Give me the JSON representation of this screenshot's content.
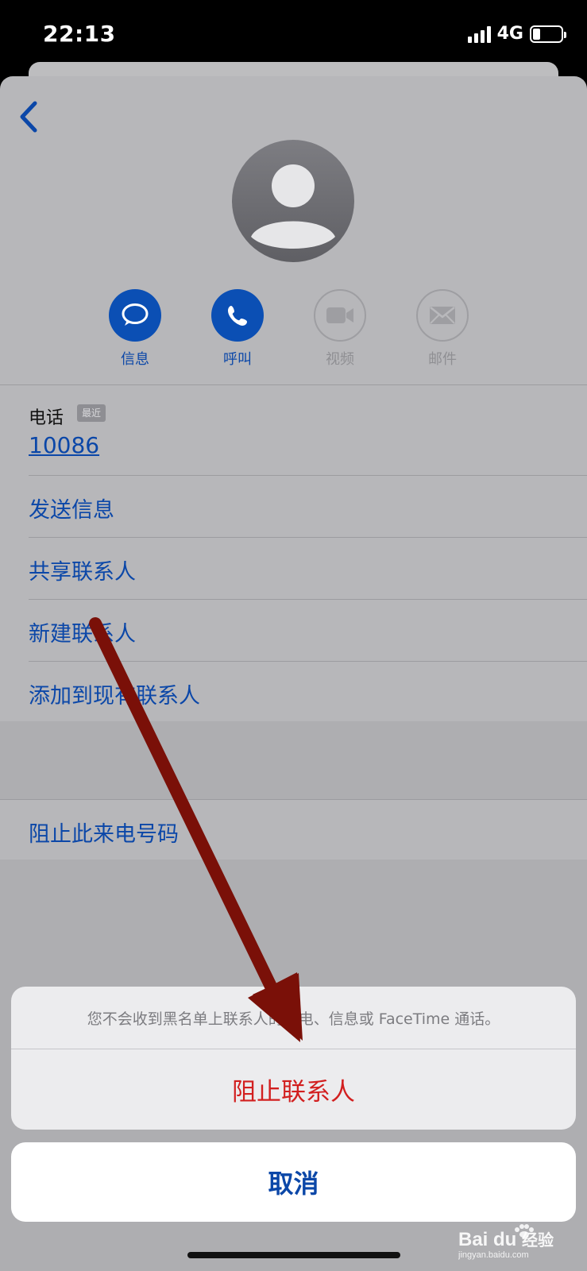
{
  "status_bar": {
    "time": "22:13",
    "network": "4G",
    "signal_bars": 4,
    "battery_level": 0.25
  },
  "contact": {
    "avatar_icon": "person-silhouette-icon",
    "actions": [
      {
        "label": "信息",
        "icon": "message-bubble-icon",
        "enabled": true
      },
      {
        "label": "呼叫",
        "icon": "phone-icon",
        "enabled": true
      },
      {
        "label": "视频",
        "icon": "video-camera-icon",
        "enabled": false
      },
      {
        "label": "邮件",
        "icon": "envelope-icon",
        "enabled": false
      }
    ],
    "phone": {
      "label": "电话",
      "badge": "最近",
      "number": "10086"
    },
    "options": [
      {
        "label": "发送信息"
      },
      {
        "label": "共享联系人"
      },
      {
        "label": "新建联系人"
      },
      {
        "label": "添加到现有联系人"
      }
    ],
    "block_caller": "阻止此来电号码"
  },
  "action_sheet": {
    "message": "您不会收到黑名单上联系人的来电、信息或 FaceTime 通话。",
    "block_button": "阻止联系人",
    "cancel_button": "取消"
  },
  "watermark": {
    "text": "Baidu经验",
    "url": "jingyan.baidu.com"
  },
  "colors": {
    "accent_blue": "#0b47a8",
    "destructive_red": "#d21f1f",
    "annotation_arrow": "#7a1008"
  }
}
